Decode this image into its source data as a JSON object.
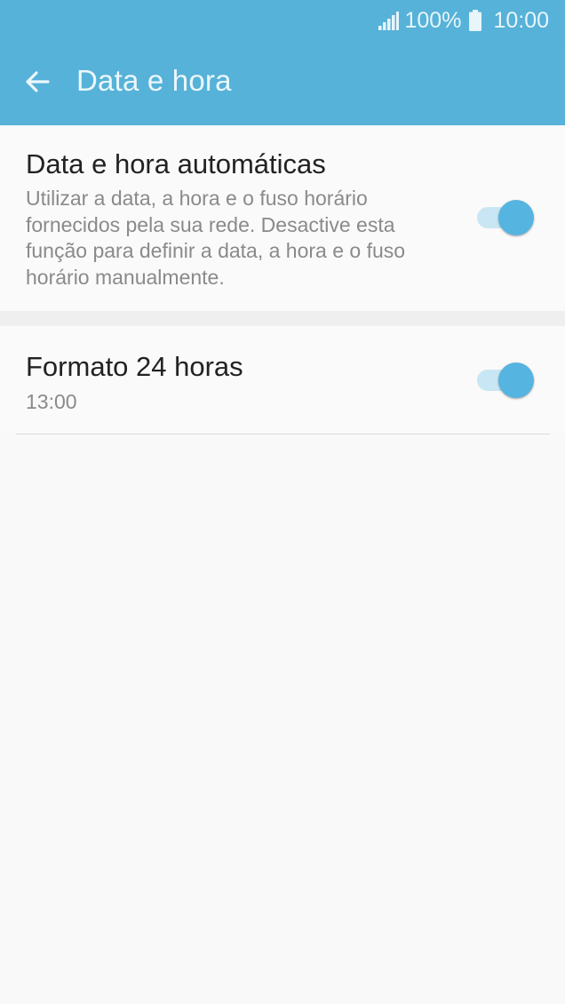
{
  "colors": {
    "accent": "#56b2d8",
    "toggle_thumb": "#56b4e0",
    "toggle_track": "#c8e6f3",
    "title_text": "#222222",
    "secondary_text": "#8a8a8a",
    "background": "#f9f9f9"
  },
  "status_bar": {
    "signal_icon": "signal-bars-icon",
    "battery_percent": "100%",
    "battery_icon": "battery-icon",
    "time": "10:00"
  },
  "app_bar": {
    "back_icon": "arrow-left-icon",
    "title": "Data e hora"
  },
  "settings": [
    {
      "title": "Data e hora automáticas",
      "description": "Utilizar a data, a hora e o fuso horário fornecidos pela sua rede. Desactive esta função para definir a data, a hora e o fuso horário manualmente.",
      "toggle_on": true
    },
    {
      "title": "Formato 24 horas",
      "summary": "13:00",
      "toggle_on": true
    }
  ]
}
